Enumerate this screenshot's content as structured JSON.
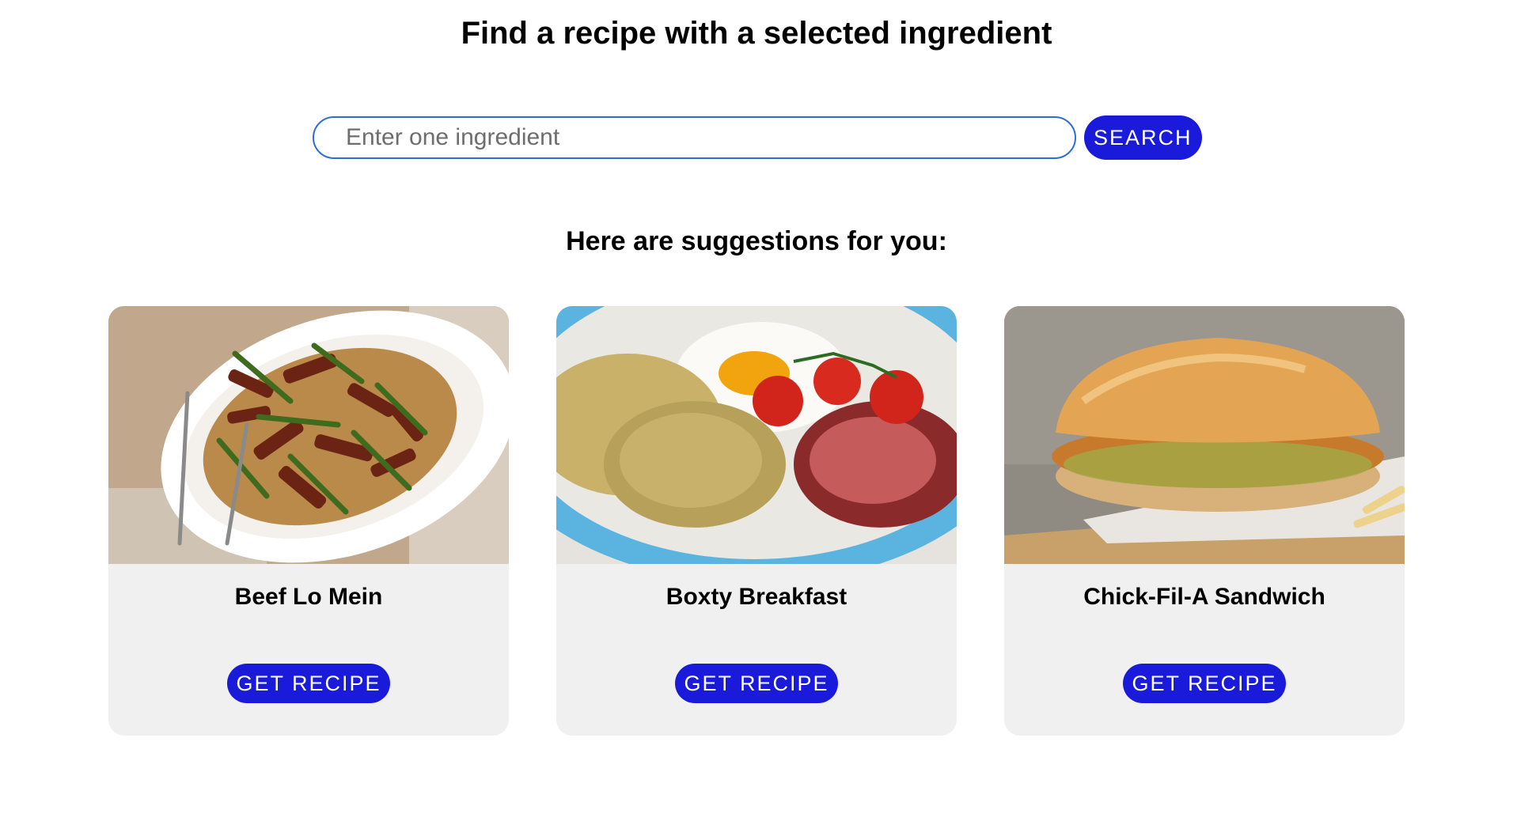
{
  "header": {
    "title": "Find a recipe with a selected ingredient"
  },
  "search": {
    "placeholder": "Enter one ingredient",
    "value": "",
    "button_label": "SEARCH"
  },
  "suggestions": {
    "heading": "Here are suggestions for you:",
    "cards": [
      {
        "title": "Beef Lo Mein",
        "button_label": "GET RECIPE",
        "image": "beef-lo-mein-photo"
      },
      {
        "title": "Boxty Breakfast",
        "button_label": "GET RECIPE",
        "image": "boxty-breakfast-photo"
      },
      {
        "title": "Chick-Fil-A Sandwich",
        "button_label": "GET RECIPE",
        "image": "chicken-sandwich-photo"
      }
    ]
  },
  "colors": {
    "accent": "#1a1adb",
    "input_border": "#2b6fd6",
    "card_background": "#f0f0f0"
  }
}
